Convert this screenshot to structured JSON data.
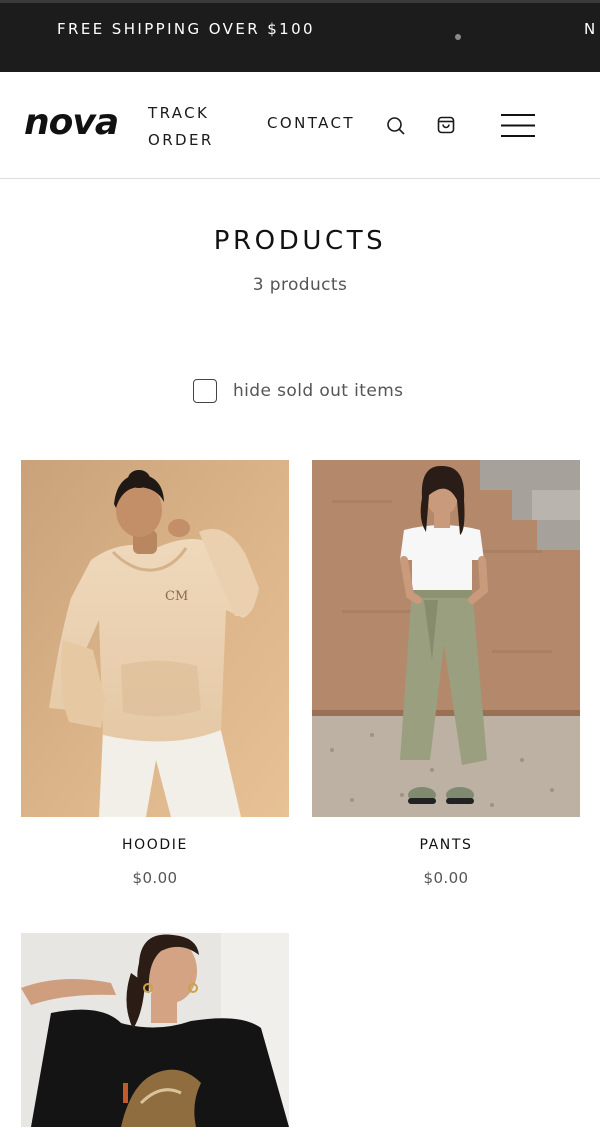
{
  "announcement": {
    "message": "FREE SHIPPING OVER $100",
    "next_message_start": "N"
  },
  "header": {
    "logo": "nova",
    "nav": {
      "track_order_line1": "TRACK",
      "track_order_line2": "ORDER",
      "contact": "CONTACT"
    },
    "icons": [
      "search-icon",
      "cart-icon",
      "menu-icon"
    ]
  },
  "collection": {
    "title": "PRODUCTS",
    "count": "3 products",
    "filter_label": "hide sold out items"
  },
  "products": [
    {
      "name": "HOODIE",
      "price": "$0.00",
      "image_logo": "CM"
    },
    {
      "name": "PANTS",
      "price": "$0.00"
    },
    {
      "name": "",
      "price": ""
    }
  ],
  "colors": {
    "announcement_bg": "#1c1c1c",
    "text": "#111111",
    "muted": "#555555"
  }
}
